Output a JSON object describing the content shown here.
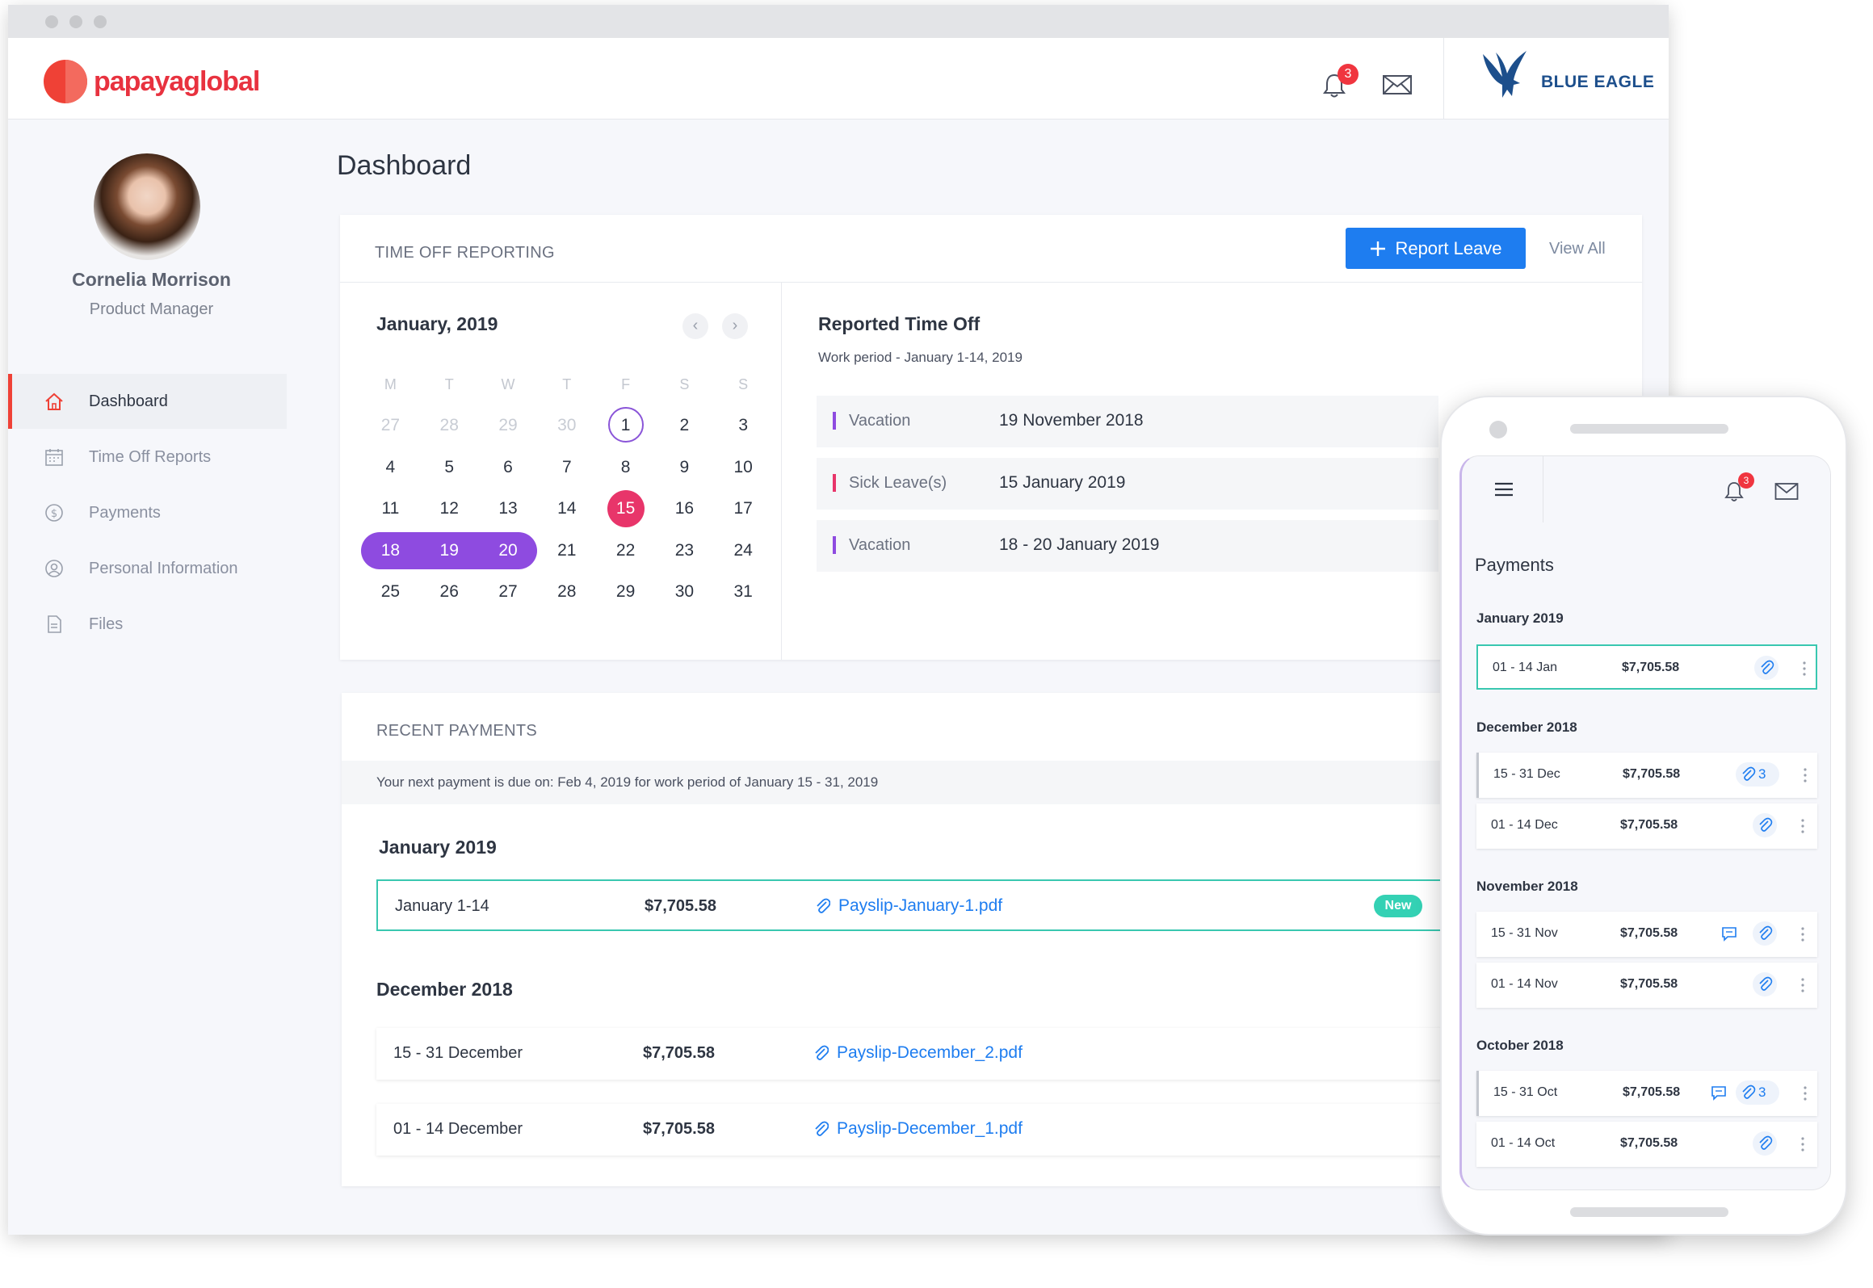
{
  "app": {
    "logo_text": "papayaglobal",
    "brand_text": "BLUE EAGLE",
    "notification_count": "3"
  },
  "user": {
    "name": "Cornelia Morrison",
    "role": "Product Manager"
  },
  "nav": {
    "items": [
      {
        "label": "Dashboard",
        "icon": "home-icon"
      },
      {
        "label": "Time Off Reports",
        "icon": "calendar-icon"
      },
      {
        "label": "Payments",
        "icon": "dollar-circle-icon"
      },
      {
        "label": "Personal Information",
        "icon": "user-circle-icon"
      },
      {
        "label": "Files",
        "icon": "file-icon"
      }
    ]
  },
  "page": {
    "title": "Dashboard"
  },
  "time_off": {
    "title": "TIME OFF REPORTING",
    "report_button": "Report Leave",
    "view_all": "View All",
    "calendar": {
      "month": "January, 2019",
      "weekdays": [
        "M",
        "T",
        "W",
        "T",
        "F",
        "S",
        "S"
      ],
      "weeks": [
        [
          "27",
          "28",
          "29",
          "30",
          "1",
          "2",
          "3"
        ],
        [
          "4",
          "5",
          "6",
          "7",
          "8",
          "9",
          "10"
        ],
        [
          "11",
          "12",
          "13",
          "14",
          "15",
          "16",
          "17"
        ],
        [
          "18",
          "19",
          "20",
          "21",
          "22",
          "23",
          "24"
        ],
        [
          "25",
          "26",
          "27",
          "28",
          "29",
          "30",
          "31"
        ]
      ]
    },
    "reported": {
      "title": "Reported Time Off",
      "subtitle": "Work period - January 1-14, 2019",
      "items": [
        {
          "type": "Vacation",
          "date": "19 November 2018"
        },
        {
          "type": "Sick Leave(s)",
          "date": "15 January 2019"
        },
        {
          "type": "Vacation",
          "date": "18 - 20 January 2019"
        }
      ]
    }
  },
  "recent_payments": {
    "title": "RECENT PAYMENTS",
    "note": "Your next payment is due on: Feb 4, 2019 for work period of January 15 - 31, 2019",
    "groups": [
      {
        "label": "January 2019",
        "rows": [
          {
            "period": "January 1-14",
            "amount": "$7,705.58",
            "file": "Payslip-January-1.pdf",
            "badge": "New"
          }
        ]
      },
      {
        "label": "December 2018",
        "rows": [
          {
            "period": "15 - 31 December",
            "amount": "$7,705.58",
            "file": "Payslip-December_2.pdf"
          },
          {
            "period": "01 - 14 December",
            "amount": "$7,705.58",
            "file": "Payslip-December_1.pdf"
          }
        ]
      }
    ]
  },
  "mobile": {
    "notification_count": "3",
    "title": "Payments",
    "groups": [
      {
        "label": "January 2019",
        "rows": [
          {
            "period": "01 - 14 Jan",
            "amount": "$7,705.58"
          }
        ]
      },
      {
        "label": "December 2018",
        "rows": [
          {
            "period": "15 - 31 Dec",
            "amount": "$7,705.58",
            "attachments": "3"
          },
          {
            "period": "01 - 14 Dec",
            "amount": "$7,705.58"
          }
        ]
      },
      {
        "label": "November 2018",
        "rows": [
          {
            "period": "15 - 31 Nov",
            "amount": "$7,705.58"
          },
          {
            "period": "01 - 14 Nov",
            "amount": "$7,705.58"
          }
        ]
      },
      {
        "label": "October 2018",
        "rows": [
          {
            "period": "15 - 31 Oct",
            "amount": "$7,705.58",
            "attachments": "3"
          },
          {
            "period": "01 - 14 Oct",
            "amount": "$7,705.58"
          }
        ]
      }
    ]
  },
  "colors": {
    "brand_red": "#ef4136",
    "accent_blue": "#1e7df0",
    "purple": "#8e4be0",
    "pink": "#e8356a",
    "teal": "#34d1b4"
  }
}
